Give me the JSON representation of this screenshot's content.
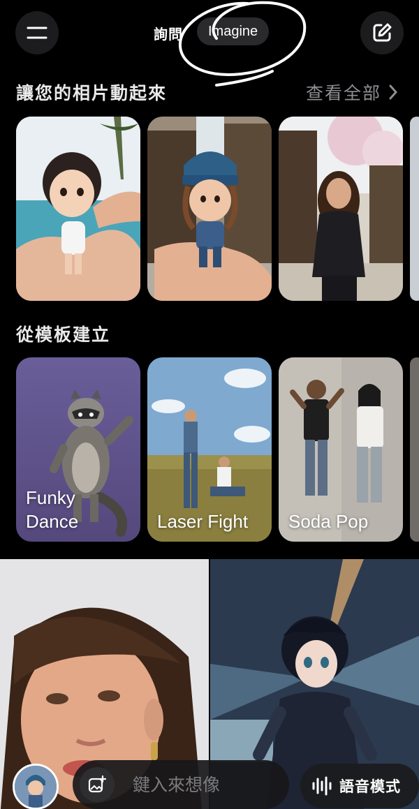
{
  "header": {
    "menu_icon": "hamburger-menu-icon",
    "tab_ask": "詢問",
    "tab_imagine": "Imagine",
    "edit_icon": "compose-icon"
  },
  "photos_section": {
    "title": "讓您的相片動起來",
    "see_all": "查看全部",
    "chevron_icon": "chevron-right-icon"
  },
  "template_section": {
    "title": "從模板建立",
    "templates": [
      {
        "label": "Funky\nDance"
      },
      {
        "label": "Laser Fight"
      },
      {
        "label": "Soda Pop"
      }
    ]
  },
  "bottom_bar": {
    "add_image_icon": "image-plus-icon",
    "prompt_placeholder": "鍵入來想像",
    "voice_icon": "waveform-icon",
    "voice_label": "語音模式"
  },
  "colors": {
    "background": "#000000",
    "button_bg": "#1c1c1e",
    "muted_text": "#8e8e93"
  }
}
